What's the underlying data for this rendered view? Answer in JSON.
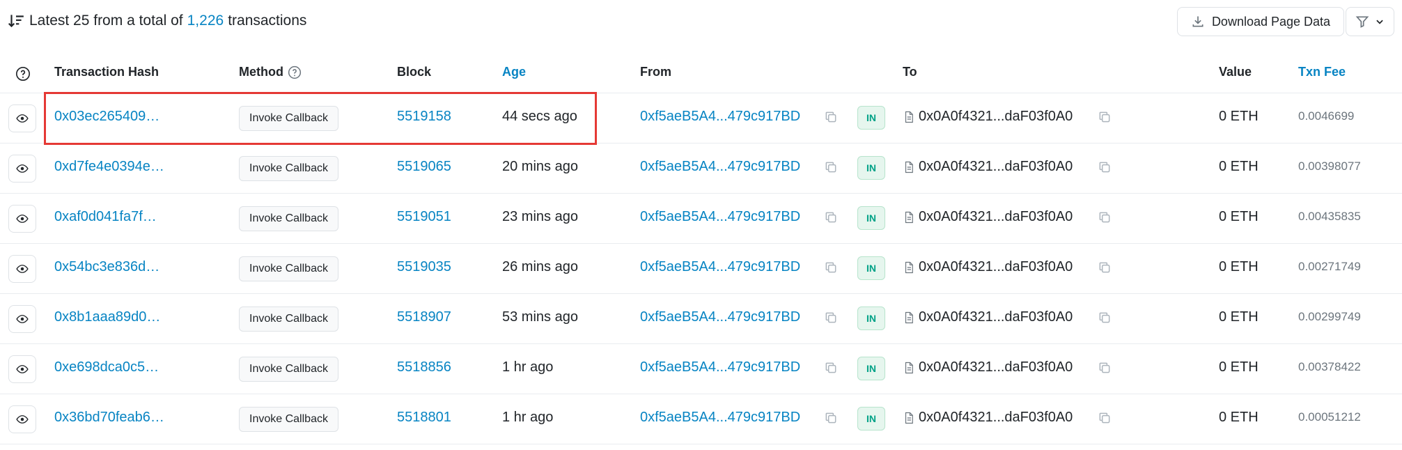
{
  "summary": {
    "prefix": "Latest 25 from a total of",
    "count": "1,226",
    "suffix": "transactions"
  },
  "toolbar": {
    "download_label": "Download Page Data"
  },
  "table": {
    "headers": {
      "hash": "Transaction Hash",
      "method": "Method",
      "block": "Block",
      "age": "Age",
      "from": "From",
      "to": "To",
      "value": "Value",
      "fee": "Txn Fee"
    },
    "rows": [
      {
        "hash": "0x03ec265409…",
        "method": "Invoke Callback",
        "block": "5519158",
        "age": "44 secs ago",
        "from": "0xf5aeB5A4...479c917BD",
        "direction": "IN",
        "to": "0x0A0f4321...daF03f0A0",
        "value": "0 ETH",
        "fee": "0.0046699"
      },
      {
        "hash": "0xd7fe4e0394e…",
        "method": "Invoke Callback",
        "block": "5519065",
        "age": "20 mins ago",
        "from": "0xf5aeB5A4...479c917BD",
        "direction": "IN",
        "to": "0x0A0f4321...daF03f0A0",
        "value": "0 ETH",
        "fee": "0.00398077"
      },
      {
        "hash": "0xaf0d041fa7f…",
        "method": "Invoke Callback",
        "block": "5519051",
        "age": "23 mins ago",
        "from": "0xf5aeB5A4...479c917BD",
        "direction": "IN",
        "to": "0x0A0f4321...daF03f0A0",
        "value": "0 ETH",
        "fee": "0.00435835"
      },
      {
        "hash": "0x54bc3e836d…",
        "method": "Invoke Callback",
        "block": "5519035",
        "age": "26 mins ago",
        "from": "0xf5aeB5A4...479c917BD",
        "direction": "IN",
        "to": "0x0A0f4321...daF03f0A0",
        "value": "0 ETH",
        "fee": "0.00271749"
      },
      {
        "hash": "0x8b1aaa89d0…",
        "method": "Invoke Callback",
        "block": "5518907",
        "age": "53 mins ago",
        "from": "0xf5aeB5A4...479c917BD",
        "direction": "IN",
        "to": "0x0A0f4321...daF03f0A0",
        "value": "0 ETH",
        "fee": "0.00299749"
      },
      {
        "hash": "0xe698dca0c5…",
        "method": "Invoke Callback",
        "block": "5518856",
        "age": "1 hr ago",
        "from": "0xf5aeB5A4...479c917BD",
        "direction": "IN",
        "to": "0x0A0f4321...daF03f0A0",
        "value": "0 ETH",
        "fee": "0.00378422"
      },
      {
        "hash": "0x36bd70feab6…",
        "method": "Invoke Callback",
        "block": "5518801",
        "age": "1 hr ago",
        "from": "0xf5aeB5A4...479c917BD",
        "direction": "IN",
        "to": "0x0A0f4321...daF03f0A0",
        "value": "0 ETH",
        "fee": "0.00051212"
      }
    ]
  },
  "colors": {
    "link": "#0784c3",
    "highlight": "#e53935",
    "in_badge": "#00a186"
  }
}
